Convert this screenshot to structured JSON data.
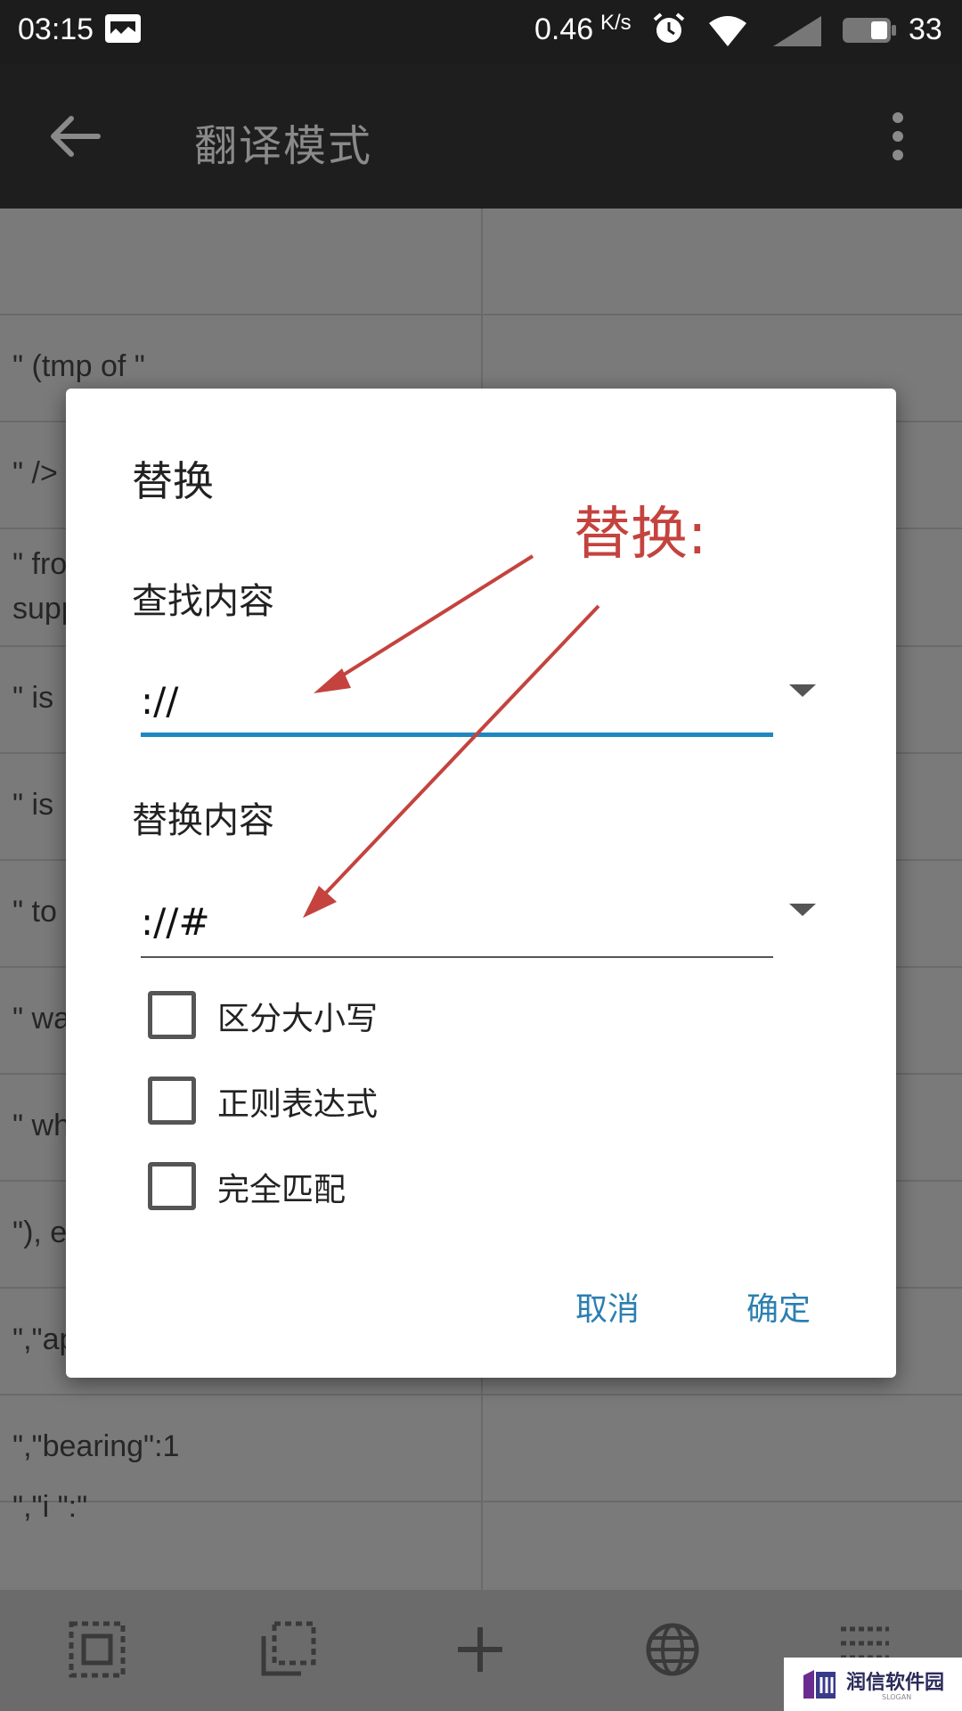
{
  "status_bar": {
    "time": "03:15",
    "net_speed": "0.46",
    "net_speed_unit": "K/s",
    "battery_level": "33",
    "icons": [
      "message-icon",
      "alarm-icon",
      "wifi-icon",
      "signal-icon",
      "battery-icon"
    ]
  },
  "app_bar": {
    "title": "翻译模式",
    "back_icon": "arrow-back-icon",
    "more_icon": "more-vert-icon"
  },
  "list": {
    "rows": [
      {
        "text": ""
      },
      {
        "text": "\" (tmp of \""
      },
      {
        "text": "\" />"
      },
      {
        "text": "\" fro",
        "text2": "supp"
      },
      {
        "text": "\" is"
      },
      {
        "text": "\" is"
      },
      {
        "text": "\" to"
      },
      {
        "text": "\" wa"
      },
      {
        "text": "\" wh"
      },
      {
        "text": "\"), e"
      },
      {
        "text": "\",\"app_name :"
      },
      {
        "text": "\",\"bearing\":1"
      },
      {
        "text": "\",\"i   \":\""
      }
    ]
  },
  "dialog": {
    "title": "替换",
    "find_label": "查找内容",
    "find_value": "://",
    "replace_label": "替换内容",
    "replace_value": "://#",
    "options": [
      {
        "label": "区分大小写",
        "checked": false
      },
      {
        "label": "正则表达式",
        "checked": false
      },
      {
        "label": "完全匹配",
        "checked": false
      }
    ],
    "cancel_label": "取消",
    "ok_label": "确定",
    "accent_color": "#2b7fb0",
    "focus_line_color": "#1f86c1"
  },
  "annotation": {
    "text": "替换:",
    "color": "#c4433e"
  },
  "toolbar": {
    "icons": [
      "select-all-icon",
      "select-range-icon",
      "add-icon",
      "globe-icon",
      "list-icon"
    ]
  },
  "watermark": {
    "text": "润信软件园",
    "sub": "SLOGAN"
  }
}
